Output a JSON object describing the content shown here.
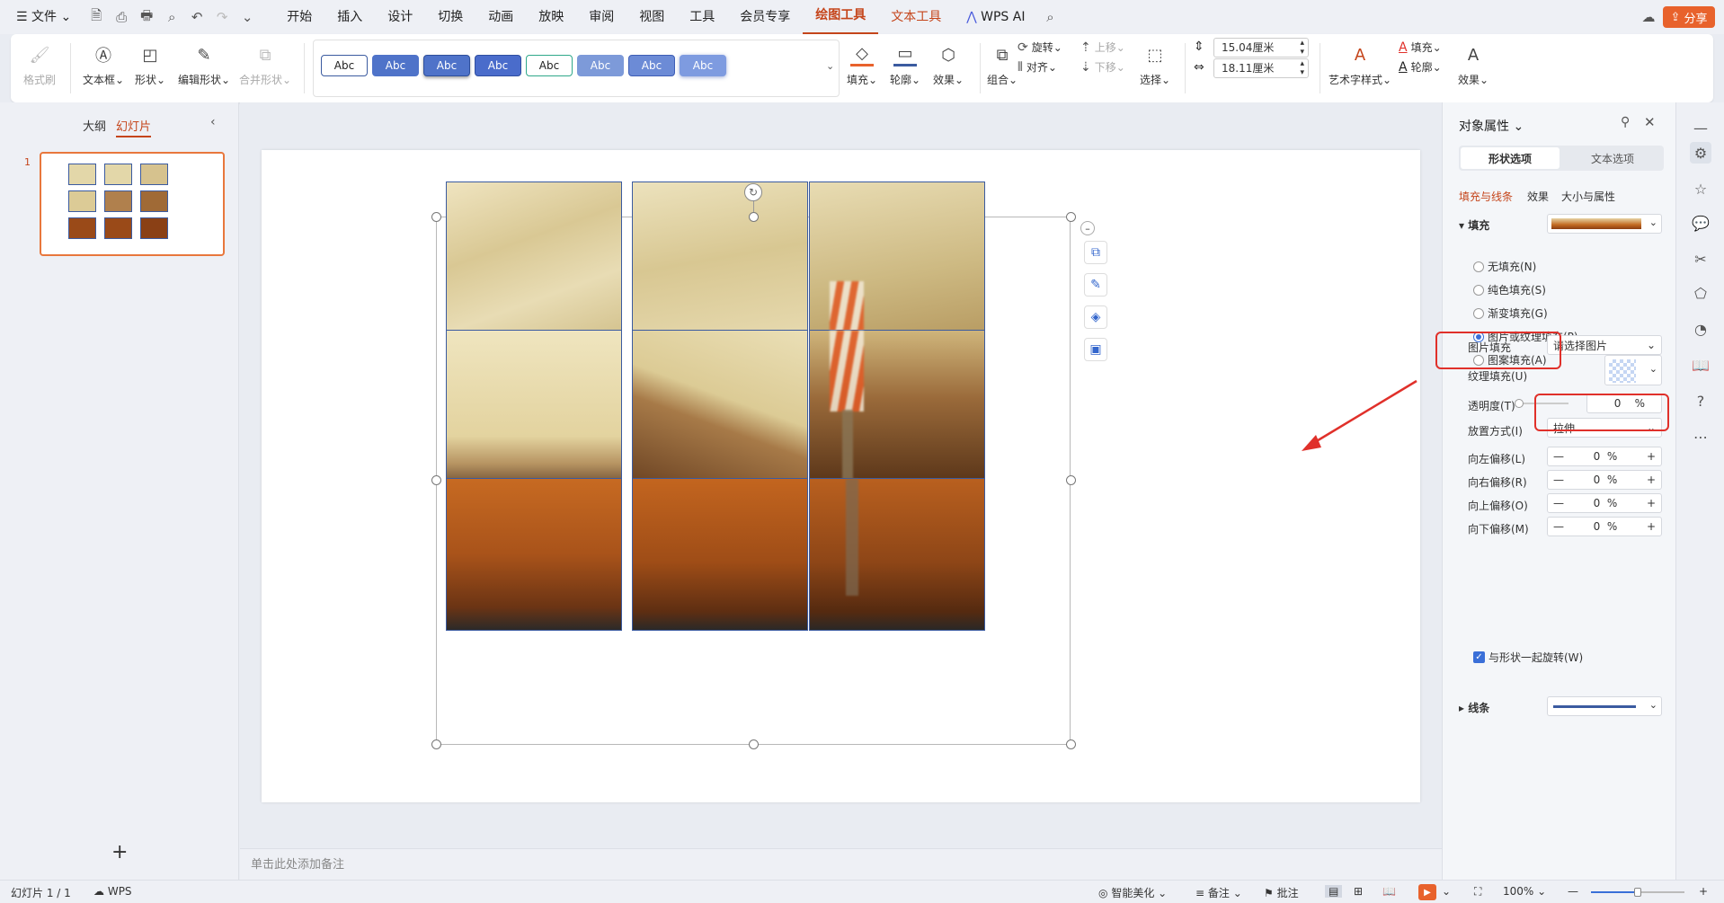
{
  "menubar": {
    "file": "文件",
    "tabs": [
      "开始",
      "插入",
      "设计",
      "切换",
      "动画",
      "放映",
      "审阅",
      "视图",
      "工具",
      "会员专享",
      "绘图工具",
      "文本工具"
    ],
    "wps_ai": "WPS AI",
    "share": "分享"
  },
  "ribbon": {
    "format_painter": "格式刷",
    "textbox": "文本框",
    "shape": "形状",
    "edit_shape": "编辑形状",
    "merge_shape": "合并形状",
    "style_samples": [
      "Abc",
      "Abc",
      "Abc",
      "Abc",
      "Abc",
      "Abc",
      "Abc",
      "Abc"
    ],
    "fill": "填充",
    "outline": "轮廓",
    "effect": "效果",
    "group": "组合",
    "rotate": "旋转",
    "align": "对齐",
    "move_up": "上移",
    "move_down": "下移",
    "select": "选择",
    "height": "15.04厘米",
    "width": "18.11厘米",
    "art_text_style": "艺术字样式",
    "text_fill": "填充",
    "text_outline": "轮廓",
    "text_effect": "效果"
  },
  "left_panel": {
    "tab_outline": "大纲",
    "tab_slides": "幻灯片",
    "slide_number": "1",
    "add_slide": "+"
  },
  "notes_placeholder": "单击此处添加备注",
  "right_panel": {
    "title": "对象属性",
    "tab_shape": "形状选项",
    "tab_text": "文本选项",
    "subtab_fill_line": "填充与线条",
    "subtab_effect": "效果",
    "subtab_size": "大小与属性",
    "fill_section": "填充",
    "fill_options": [
      "无填充(N)",
      "纯色填充(S)",
      "渐变填充(G)",
      "图片或纹理填充(P)",
      "图案填充(A)"
    ],
    "fill_selected_index": 3,
    "picture_fill_label": "图片填充",
    "picture_fill_value": "请选择图片",
    "texture_fill_label": "纹理填充(U)",
    "transparency_label": "透明度(T)",
    "transparency_value": "0",
    "transparency_unit": "%",
    "placement_label": "放置方式(I)",
    "placement_value": "拉伸",
    "offsets": [
      {
        "label": "向左偏移(L)",
        "value": "0",
        "unit": "%"
      },
      {
        "label": "向右偏移(R)",
        "value": "0",
        "unit": "%"
      },
      {
        "label": "向上偏移(O)",
        "value": "0",
        "unit": "%"
      },
      {
        "label": "向下偏移(M)",
        "value": "0",
        "unit": "%"
      }
    ],
    "rotate_with_shape": "与形状一起旋转(W)",
    "rotate_with_shape_checked": true,
    "line_section": "线条"
  },
  "statusbar": {
    "slide_info": "幻灯片 1 / 1",
    "wps": "WPS",
    "smart_beautify": "智能美化",
    "notes": "备注",
    "comments": "批注",
    "zoom": "100%"
  },
  "colors": {
    "accent": "#c5451b",
    "highlight_box": "#e0302a",
    "selection_blue": "#3a6fd8"
  }
}
